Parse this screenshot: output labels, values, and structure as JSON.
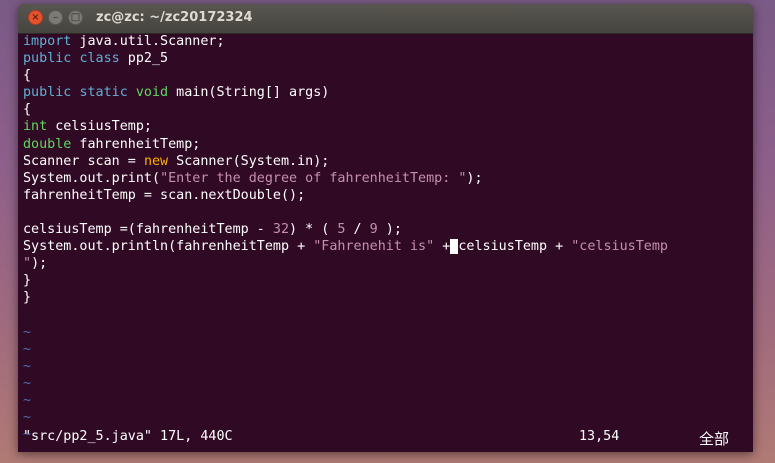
{
  "window": {
    "title": "zc@zc: ~/zc20172324",
    "buttons": {
      "close": "×",
      "minimize": "–",
      "maximize": "□"
    }
  },
  "editor": {
    "lines": [
      [
        {
          "t": "import",
          "c": "kw"
        },
        {
          "t": " java.util.Scanner;"
        }
      ],
      [
        {
          "t": "public",
          "c": "kw"
        },
        {
          "t": " "
        },
        {
          "t": "class",
          "c": "kw"
        },
        {
          "t": " pp2_5"
        }
      ],
      [
        {
          "t": "{"
        }
      ],
      [
        {
          "t": "public",
          "c": "kw"
        },
        {
          "t": " "
        },
        {
          "t": "static",
          "c": "kw"
        },
        {
          "t": " "
        },
        {
          "t": "void",
          "c": "ty"
        },
        {
          "t": " main(String[] args)"
        }
      ],
      [
        {
          "t": "{"
        }
      ],
      [
        {
          "t": "int",
          "c": "ty"
        },
        {
          "t": " celsiusTemp;"
        }
      ],
      [
        {
          "t": "double",
          "c": "ty"
        },
        {
          "t": " fahrenheitTemp;"
        }
      ],
      [
        {
          "t": "Scanner scan = "
        },
        {
          "t": "new",
          "c": "nw"
        },
        {
          "t": " Scanner(System.in);"
        }
      ],
      [
        {
          "t": "System.out.print("
        },
        {
          "t": "\"Enter the degree of fahrenheitTemp: \"",
          "c": "str"
        },
        {
          "t": ");"
        }
      ],
      [
        {
          "t": "fahrenheitTemp = scan.nextDouble();"
        }
      ],
      [
        {
          "t": ""
        }
      ],
      [
        {
          "t": "celsiusTemp =(fahrenheitTemp - "
        },
        {
          "t": "32",
          "c": "num"
        },
        {
          "t": ") * ( "
        },
        {
          "t": "5",
          "c": "num"
        },
        {
          "t": " / "
        },
        {
          "t": "9",
          "c": "num"
        },
        {
          "t": " );"
        }
      ],
      [
        {
          "t": "System.out.println(fahrenheitTemp + "
        },
        {
          "t": "\"Fahrenehit is\"",
          "c": "str"
        },
        {
          "t": " +"
        },
        {
          "t": " ",
          "c": "cursor"
        },
        {
          "t": "celsiusTemp + "
        },
        {
          "t": "\"celsiusTemp",
          "c": "str"
        }
      ],
      [
        {
          "t": "\"",
          "c": "str"
        },
        {
          "t": ");"
        }
      ],
      [
        {
          "t": "}"
        }
      ],
      [
        {
          "t": "}"
        }
      ],
      [
        {
          "t": ""
        }
      ],
      [
        {
          "t": "~",
          "c": "tilde"
        }
      ],
      [
        {
          "t": "~",
          "c": "tilde"
        }
      ],
      [
        {
          "t": "~",
          "c": "tilde"
        }
      ],
      [
        {
          "t": "~",
          "c": "tilde"
        }
      ],
      [
        {
          "t": "~",
          "c": "tilde"
        }
      ],
      [
        {
          "t": "~",
          "c": "tilde"
        }
      ],
      [
        {
          "t": "~",
          "c": "tilde"
        }
      ]
    ]
  },
  "statusbar": {
    "file_info": "\"src/pp2_5.java\" 17L, 440C",
    "cursor_pos": "13,54",
    "scroll_pos": "全部"
  },
  "colors": {
    "background": "#300a24",
    "keyword": "#5fafd7",
    "type": "#5fd75f",
    "new": "#ffaf00",
    "string": "#c58fad",
    "tilde": "#4f6fb6",
    "close_button": "#e4532d"
  }
}
